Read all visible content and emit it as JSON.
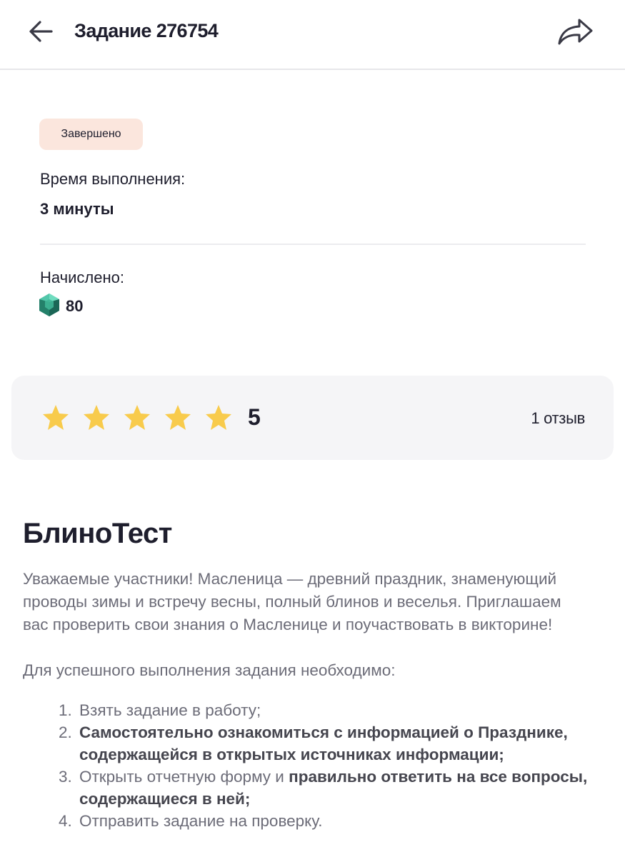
{
  "header": {
    "title": "Задание 276754"
  },
  "status": {
    "badge": "Завершено"
  },
  "details": {
    "time_label": "Время выполнения:",
    "time_value": "3 минуты",
    "credited_label": "Начислено:",
    "credited_value": "80"
  },
  "rating": {
    "stars": 5,
    "value": "5",
    "reviews": "1 отзыв",
    "star_color": "#f8cb4c"
  },
  "task": {
    "title": "БлиноТест",
    "intro_lines": [
      "Уважаемые участники! Масленица — древний праздник, знаменующий",
      "проводы зимы и встречу весны, полный блинов и веселья. Приглашаем",
      "вас проверить свои знания о Масленице и поучаствовать в викторине!"
    ],
    "requirements_heading": "Для успешного выполнения задания необходимо:",
    "steps": [
      {
        "num": "1.",
        "text": "Взять задание в работу;",
        "bold": ""
      },
      {
        "num": "2.",
        "text": "",
        "bold": "Самостоятельно ознакомиться с информацией о Празднике, содержащейся в открытых источниках информации;"
      },
      {
        "num": "3.",
        "text": "Открыть отчетную форму и ",
        "bold": "правильно ответить на все вопросы, содержащиеся в ней;"
      },
      {
        "num": "4.",
        "text": "Отправить задание на проверку.",
        "bold": ""
      }
    ]
  }
}
